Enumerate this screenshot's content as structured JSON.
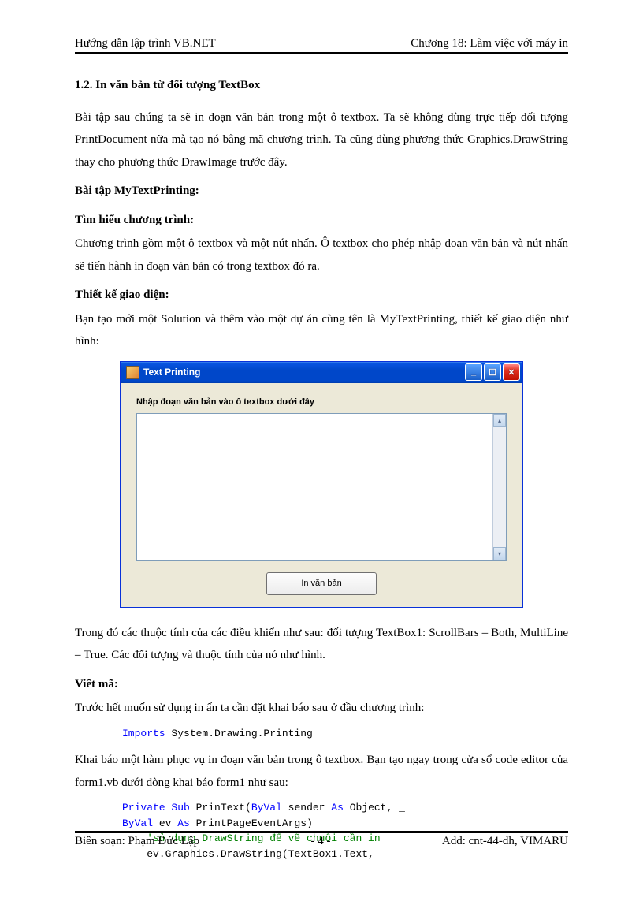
{
  "header": {
    "left": "Hướng dẫn lập trình  VB.NET",
    "right": "Chương 18: Làm việc với máy in"
  },
  "section_num": "1.2. In văn bản từ đối tượng TextBox",
  "para1": "Bài tập sau chúng ta sẽ in đoạn văn bản trong một ô textbox. Ta sẽ không dùng trực tiếp đối tượng PrintDocument  nữa mà tạo nó bằng mã chương trình.  Ta cũng dùng phương thức Graphics.DrawString   thay cho phương thức DrawImage trước đây.",
  "h_exercise": "Bài tập MyTextPrinting:",
  "h_understand": "Tìm hiểu chương trình:",
  "para2": "Chương trình  gồm một ô textbox  và một nút nhấn.  Ô textbox cho phép nhập đoạn văn  bản và nút nhấn sẽ tiến hành in đoạn văn bản có trong textbox đó ra.",
  "h_design": "Thiết kế giao diện:",
  "para3": "Bạn tạo mới một Solution và thêm vào một dự án cùng tên là MyTextPrinting,  thiết kế giao diện như hình:",
  "window": {
    "title": "Text Printing",
    "label": "Nhập đoạn văn bản vào ô textbox dưới đây",
    "button": "In văn bản"
  },
  "para4": "Trong  đó các thuộc tính  của các điều khiển  như sau: đối tượng TextBox1:  ScrollBars  – Both, MultiLine  – True.  Các đối tượng và thuộc tính  của nó như hình.",
  "h_code": "Viết mã:",
  "para5": "Trước hết muốn  sử dụng in ấn ta cần đặt khai báo sau ở đầu chương trình:",
  "code1": {
    "kw1": "Imports",
    "rest": " System.Drawing.Printing"
  },
  "para6": "Khai báo một hàm phục vụ in đoạn văn bản trong ô textbox.  Bạn tạo ngay trong cửa sổ code editor của form1.vb dưới dòng khai báo form1 như sau:",
  "code2": {
    "l1_a": "Private Sub",
    "l1_b": " PrinText(",
    "l1_c": "ByVal",
    "l1_d": " sender ",
    "l1_e": "As",
    "l1_f": " Object, _",
    "l2_a": "ByVal",
    "l2_b": " ev ",
    "l2_c": "As",
    "l2_d": " PrintPageEventArgs)",
    "l3": "    'sử dụng DrawString để vẽ chuỗi cần in",
    "l4": "    ev.Graphics.DrawString(TextBox1.Text, _"
  },
  "footer": {
    "left": "Biên soạn: Phạm Đức Lập",
    "center": "- 4 -",
    "right": "Add: cnt-44-dh, VIMARU"
  }
}
